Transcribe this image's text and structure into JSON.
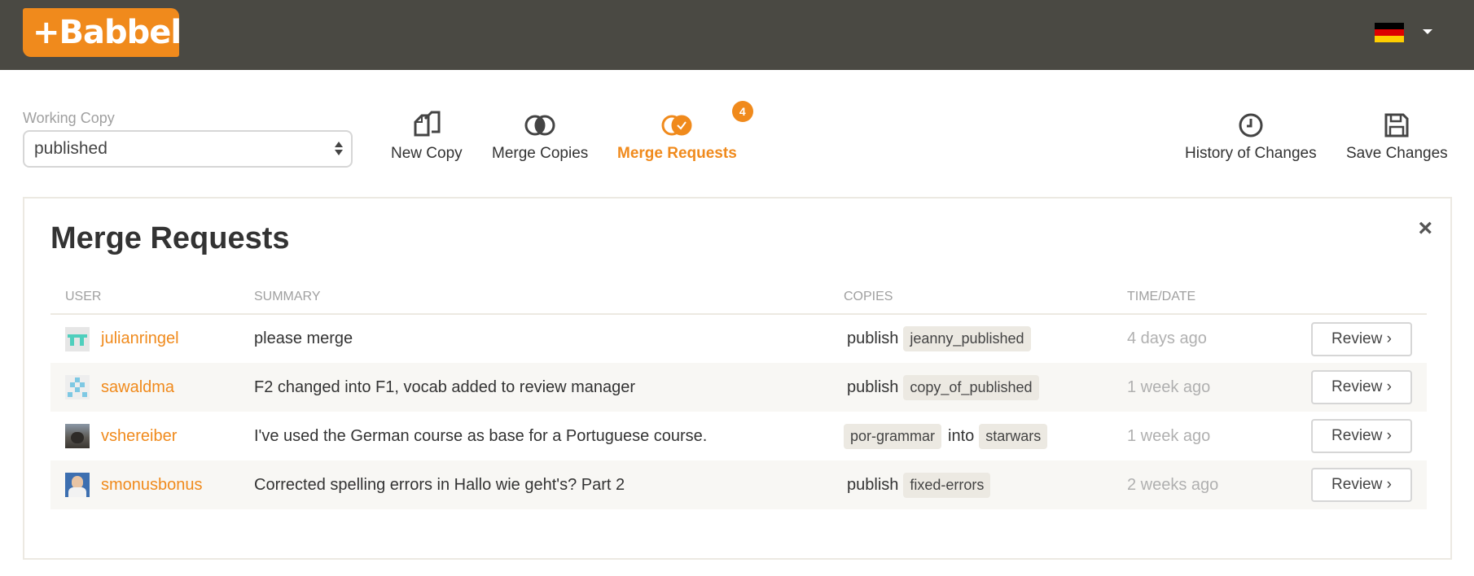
{
  "header": {
    "logo_plus": "+",
    "logo_text": "Babbel",
    "language_flag": "germany-flag-icon",
    "colors": {
      "bar": "#4a4943",
      "brand": "#f08a1c"
    }
  },
  "toolbar": {
    "working_copy_label": "Working Copy",
    "working_copy_value": "published",
    "new_copy": "New Copy",
    "merge_copies": "Merge Copies",
    "merge_requests": "Merge Requests",
    "merge_requests_count": "4",
    "history": "History of Changes",
    "save": "Save Changes"
  },
  "panel": {
    "title": "Merge Requests",
    "close": "×",
    "columns": {
      "user": "USER",
      "summary": "SUMMARY",
      "copies": "COPIES",
      "time": "TIME/DATE"
    },
    "rows": [
      {
        "user": "julianringel",
        "summary": "please merge",
        "copy_prefix": "publish",
        "copy_a": "jeanny_published",
        "copy_joiner": "",
        "copy_b": "",
        "time": "4 days ago",
        "action": "Review ›"
      },
      {
        "user": "sawaldma",
        "summary": "F2 changed into F1, vocab added to review manager",
        "copy_prefix": "publish",
        "copy_a": "copy_of_published",
        "copy_joiner": "",
        "copy_b": "",
        "time": "1 week ago",
        "action": "Review ›"
      },
      {
        "user": "vshereiber",
        "summary": "I've used the German course as base for a Portuguese course.",
        "copy_prefix": "",
        "copy_a": "por-grammar",
        "copy_joiner": "into",
        "copy_b": "starwars",
        "time": "1 week ago",
        "action": "Review ›"
      },
      {
        "user": "smonusbonus",
        "summary": "Corrected spelling errors in Hallo wie geht's? Part 2",
        "copy_prefix": "publish",
        "copy_a": "fixed-errors",
        "copy_joiner": "",
        "copy_b": "",
        "time": "2 weeks ago",
        "action": "Review ›"
      }
    ]
  }
}
